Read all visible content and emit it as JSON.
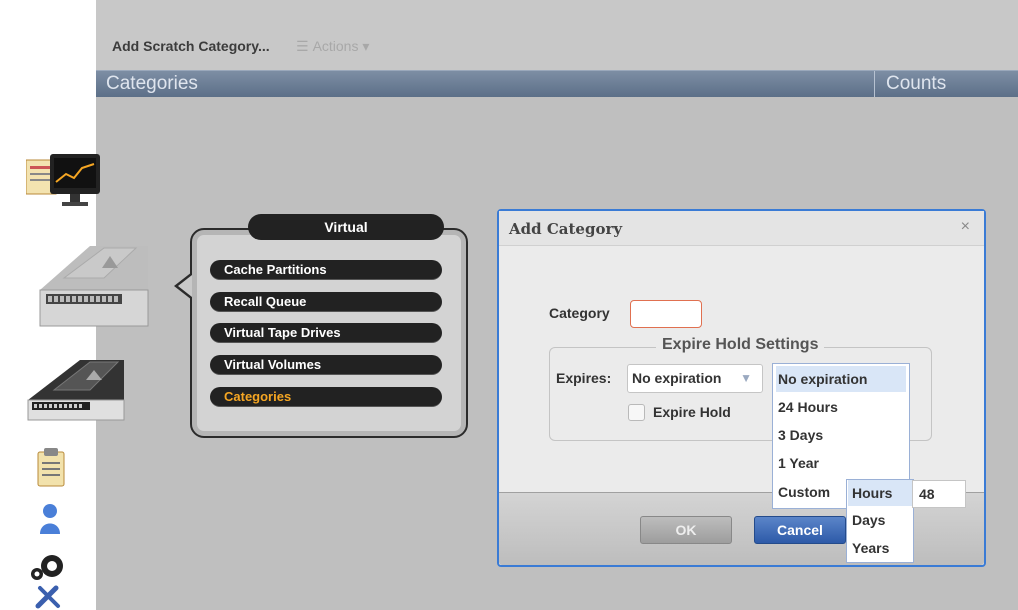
{
  "toolbar": {
    "add_label": "Add Scratch Category...",
    "actions_label": "Actions"
  },
  "table_header": {
    "categories": "Categories",
    "counts": "Counts"
  },
  "popup": {
    "title": "Virtual",
    "items": [
      {
        "label": "Cache Partitions"
      },
      {
        "label": "Recall Queue"
      },
      {
        "label": "Virtual Tape Drives"
      },
      {
        "label": "Virtual Volumes"
      },
      {
        "label": "Categories"
      }
    ]
  },
  "dialog": {
    "title": "Add Category",
    "close": "×",
    "category_label": "Category",
    "category_value": "",
    "legend": "Expire Hold Settings",
    "expires_label": "Expires:",
    "expires_value": "No expiration",
    "expire_hold_label": "Expire Hold",
    "ok_label": "OK",
    "cancel_label": "Cancel"
  },
  "dropdown": {
    "options": [
      "No expiration",
      "24 Hours",
      "3 Days",
      "1 Year",
      "Custom"
    ]
  },
  "custom": {
    "units": [
      "Hours",
      "Days",
      "Years"
    ],
    "value": "48"
  },
  "colors": {
    "accent_blue": "#3a7bd5",
    "active_menu": "#f5a623"
  }
}
